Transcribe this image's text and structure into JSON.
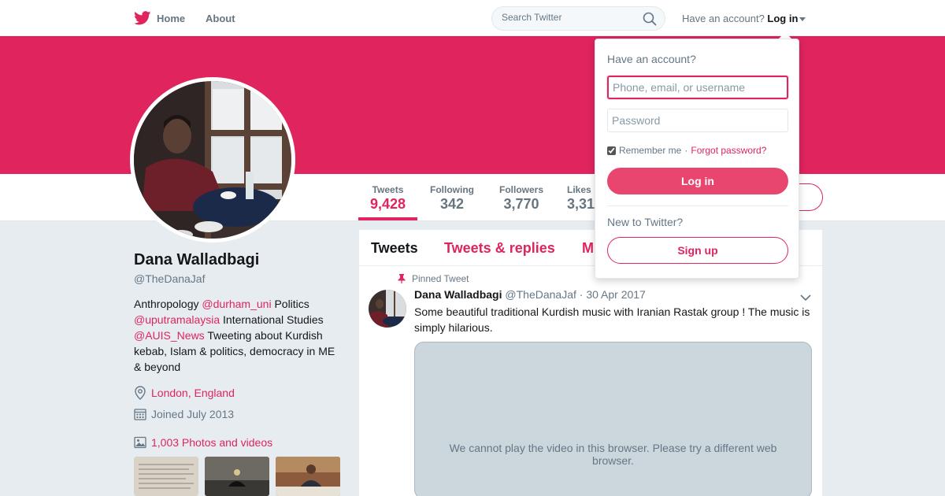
{
  "nav": {
    "home_label": "Home",
    "about_label": "About",
    "search_placeholder": "Search Twitter",
    "have_account": "Have an account?",
    "login_label": "Log in"
  },
  "colors": {
    "accent": "#e0245e",
    "banner": "#e0245e",
    "login_button": "#e8466f"
  },
  "profile": {
    "name": "Dana Walladbagi",
    "handle": "@TheDanaJaf",
    "bio": [
      {
        "text": "Anthropology ",
        "link": false
      },
      {
        "text": "@durham_uni",
        "link": true
      },
      {
        "text": " Politics ",
        "link": false
      },
      {
        "text": "@uputramalaysia",
        "link": true
      },
      {
        "text": " International Studies ",
        "link": false
      },
      {
        "text": "@AUIS_News",
        "link": true
      },
      {
        "text": " Tweeting about Kurdish kebab, Islam & politics, democracy in ME & beyond",
        "link": false
      }
    ],
    "location": "London, England",
    "joined": "Joined July 2013",
    "photos_label": "1,003 Photos and videos"
  },
  "stats": [
    {
      "label": "Tweets",
      "value": "9,428"
    },
    {
      "label": "Following",
      "value": "342"
    },
    {
      "label": "Followers",
      "value": "3,770"
    },
    {
      "label": "Likes",
      "value": "3,31"
    }
  ],
  "timeline": {
    "tabs": [
      "Tweets",
      "Tweets & replies",
      "M"
    ],
    "pinned_label": "Pinned Tweet",
    "tweet": {
      "name": "Dana Walladbagi",
      "handle": "@TheDanaJaf",
      "date": "· 30 Apr 2017",
      "text": "Some beautiful traditional Kurdish music with Iranian Rastak group ! The music is simply hilarious.",
      "video_message": "We cannot play the video in this browser. Please try a different web browser."
    }
  },
  "login_dropdown": {
    "title": "Have an account?",
    "username_placeholder": "Phone, email, or username",
    "password_placeholder": "Password",
    "remember_label": "Remember me",
    "separator": " · ",
    "forgot_label": "Forgot password?",
    "login_button": "Log in",
    "new_label": "New to Twitter?",
    "signup_button": "Sign up"
  },
  "icons": [
    "twitter-bird-icon",
    "search-icon",
    "location-icon",
    "calendar-icon",
    "photo-icon",
    "pin-icon",
    "chevron-down-icon"
  ]
}
